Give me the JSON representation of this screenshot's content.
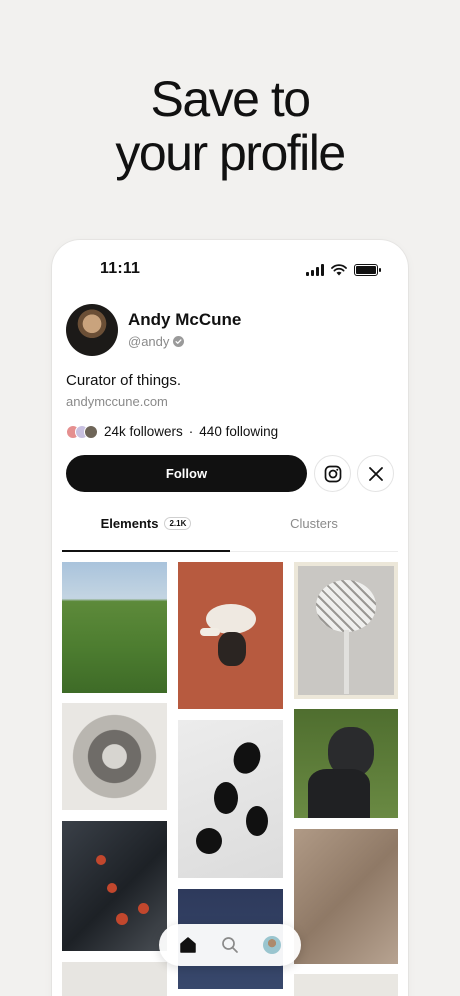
{
  "headline": {
    "line1": "Save to",
    "line2": "your profile"
  },
  "status_bar": {
    "time": "11:11"
  },
  "profile": {
    "name": "Andy McCune",
    "handle": "@andy",
    "bio": "Curator of things.",
    "website": "andymccune.com",
    "followers_text": "24k followers",
    "separator": "·",
    "following_text": "440 following"
  },
  "actions": {
    "follow_label": "Follow"
  },
  "tabs": [
    {
      "label": "Elements",
      "badge": "2.1K",
      "active": true
    },
    {
      "label": "Clusters",
      "active": false
    }
  ],
  "icons": [
    "signal-icon",
    "wifi-icon",
    "battery-icon",
    "verified-icon",
    "instagram-icon",
    "x-icon",
    "home-icon",
    "search-icon",
    "profile-avatar"
  ],
  "colors": {
    "background": "#f2f1ef",
    "primary": "#111111",
    "muted": "#8a8a8a"
  }
}
